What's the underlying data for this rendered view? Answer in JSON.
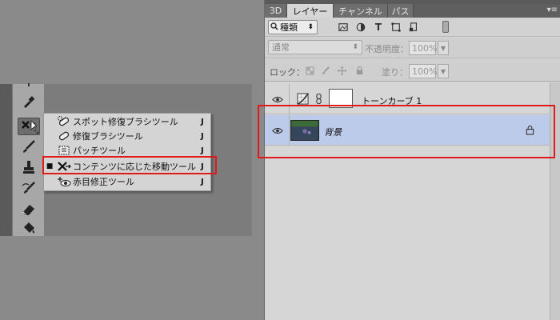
{
  "tools": {
    "items": [
      {
        "icon": "eyedropper-icon"
      },
      {
        "icon": "content-aware-move-icon"
      },
      {
        "icon": "brush-icon"
      },
      {
        "icon": "stamp-icon"
      },
      {
        "icon": "history-brush-icon"
      },
      {
        "icon": "eraser-icon"
      },
      {
        "icon": "paint-bucket-icon"
      }
    ]
  },
  "flyout": {
    "items": [
      {
        "label": "スポット修復ブラシツール",
        "key": "J",
        "bullet": ""
      },
      {
        "label": "修復ブラシツール",
        "key": "J",
        "bullet": ""
      },
      {
        "label": "パッチツール",
        "key": "J",
        "bullet": ""
      },
      {
        "label": "コンテンツに応じた移動ツール",
        "key": "J",
        "bullet": "■"
      },
      {
        "label": "赤目修正ツール",
        "key": "J",
        "bullet": ""
      }
    ]
  },
  "panel": {
    "tabs": [
      "3D",
      "レイヤー",
      "チャンネル",
      "パス"
    ],
    "active_tab": "レイヤー",
    "menu_glyph": "▾≡",
    "filter": {
      "icon": "search-icon",
      "label": "種類",
      "arrows": "⬍"
    },
    "blend_mode": {
      "value": "通常",
      "arrows": "⬍"
    },
    "opacity": {
      "label": "不透明度：",
      "value": "100%"
    },
    "lock": {
      "label": "ロック：",
      "fill_label": "塗り：",
      "fill_value": "100%"
    },
    "layers": [
      {
        "name": "トーンカーブ 1",
        "selected": false
      },
      {
        "name": "背景",
        "selected": true,
        "locked": true
      }
    ]
  },
  "colors": {
    "highlight": "#e01a1a",
    "selected_layer": "#bccbe9"
  }
}
